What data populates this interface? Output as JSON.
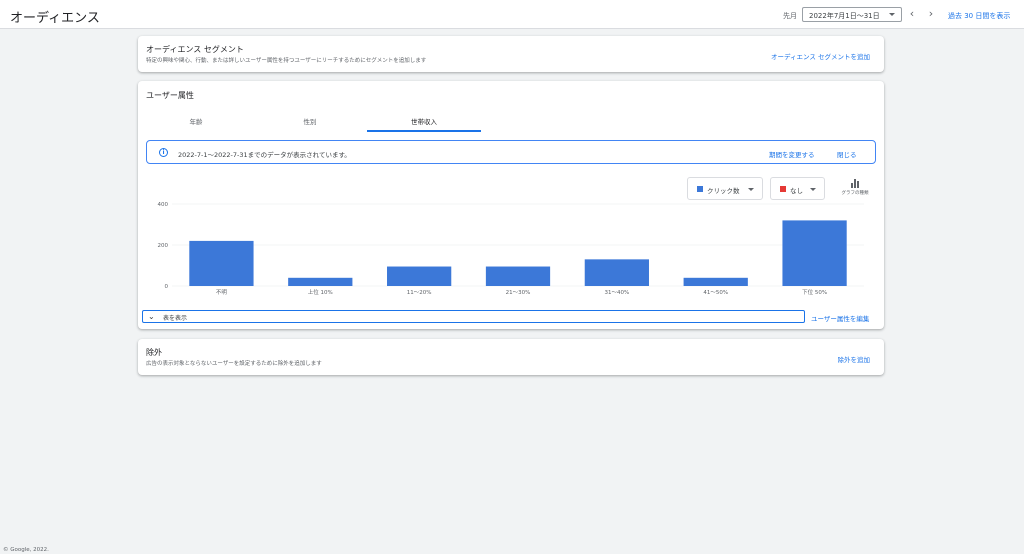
{
  "header": {
    "title": "オーディエンス",
    "period_label": "先月",
    "date_range": "2022年7月1日～31日",
    "last30_label": "過去 30 日間を表示"
  },
  "segments": {
    "title": "オーディエンス セグメント",
    "subtitle": "特定の興味や関心、行動、または詳しいユーザー属性を持つユーザーにリーチするためにセグメントを追加します",
    "add_link": "オーディエンス セグメントを追加"
  },
  "demographics": {
    "title": "ユーザー属性",
    "tabs": [
      {
        "label": "年齢",
        "active": false
      },
      {
        "label": "性別",
        "active": false
      },
      {
        "label": "世帯収入",
        "active": true
      }
    ],
    "info": {
      "text": "2022-7-1～2022-7-31までのデータが表示されています。",
      "change_period": "期間を変更する",
      "close": "閉じる"
    },
    "metric_primary": {
      "label": "クリック数",
      "color": "#3c78d8"
    },
    "metric_secondary": {
      "label": "なし",
      "color": "#e53935"
    },
    "chart_type_label": "グラフの種類",
    "show_table": "表を表示",
    "edit_link": "ユーザー属性を編集"
  },
  "chart_data": {
    "type": "bar",
    "categories": [
      "不明",
      "上位 10%",
      "11～20%",
      "21～30%",
      "31～40%",
      "41～50%",
      "下位 50%"
    ],
    "values": [
      220,
      40,
      95,
      95,
      130,
      40,
      320
    ],
    "y_ticks": [
      0,
      200,
      400
    ],
    "ylim": [
      0,
      400
    ],
    "bar_color": "#3c78d8",
    "grid": true
  },
  "exclusions": {
    "title": "除外",
    "subtitle": "広告の表示対象とならないユーザーを設定するために除外を追加します",
    "add_link": "除外を追加"
  },
  "footer": {
    "copyright": "© Google, 2022."
  }
}
